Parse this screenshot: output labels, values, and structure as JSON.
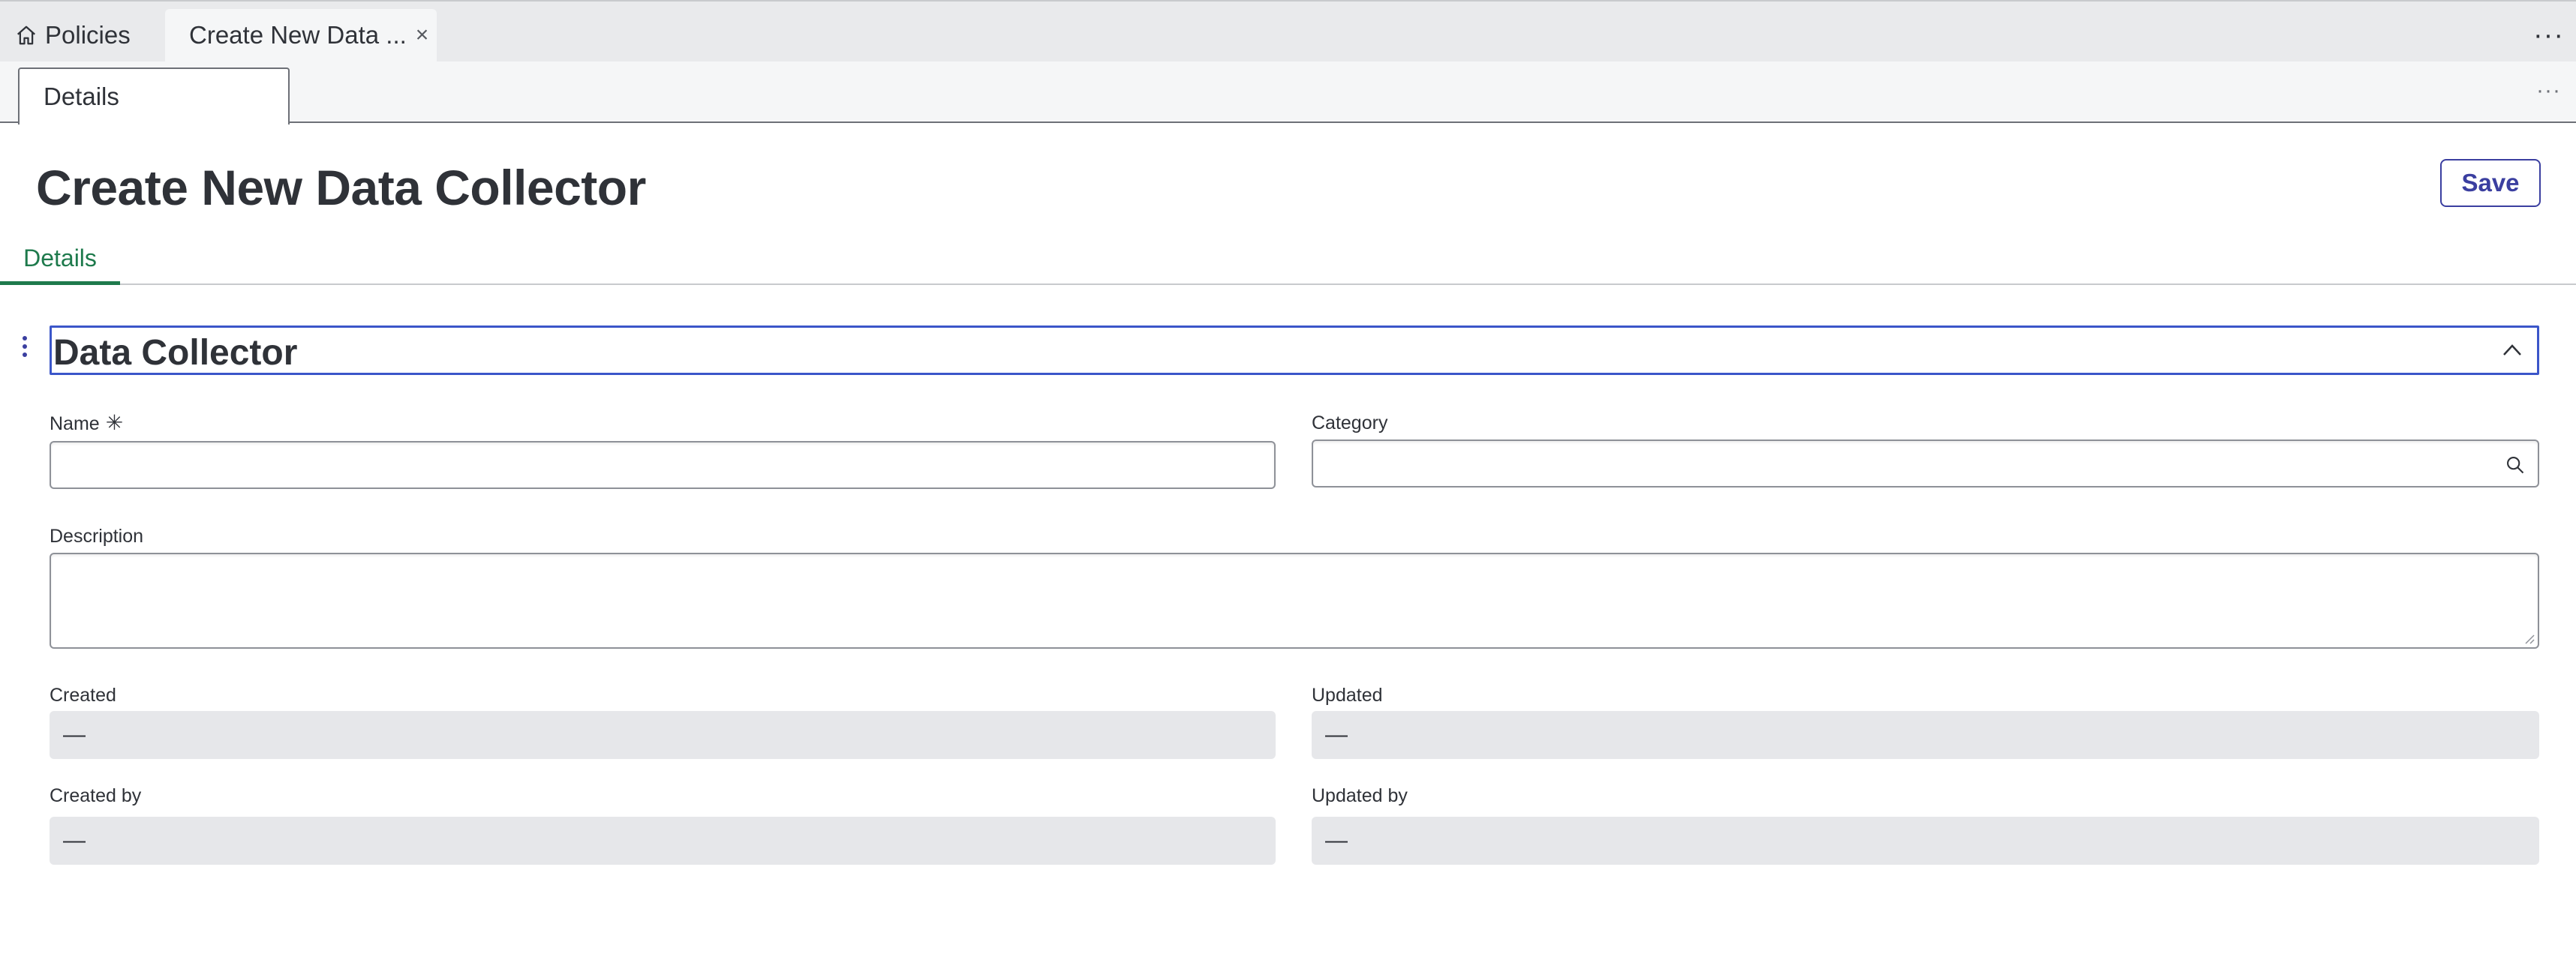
{
  "workspace_tabs": {
    "home_label": "Policies",
    "active_label": "Create New Data ...",
    "close_glyph": "×",
    "more_glyph": "···"
  },
  "form_tabbar": {
    "tab_label": "Details",
    "more_glyph": "···"
  },
  "header": {
    "title": "Create New Data Collector",
    "save_label": "Save"
  },
  "section_tabs": {
    "active_label": "Details"
  },
  "section": {
    "title": "Data Collector",
    "accent_color": "#3b56c9"
  },
  "fields": {
    "name": {
      "label": "Name",
      "required_mark": "✳",
      "value": ""
    },
    "category": {
      "label": "Category",
      "value": ""
    },
    "description": {
      "label": "Description",
      "value": ""
    },
    "created": {
      "label": "Created",
      "value": "—"
    },
    "updated": {
      "label": "Updated",
      "value": "—"
    },
    "created_by": {
      "label": "Created by",
      "value": "—"
    },
    "updated_by": {
      "label": "Updated by",
      "value": "—"
    }
  },
  "colors": {
    "primary": "#3b3fa0",
    "active_tab": "#1e7a4c",
    "readonly_bg": "#e6e7ea"
  }
}
